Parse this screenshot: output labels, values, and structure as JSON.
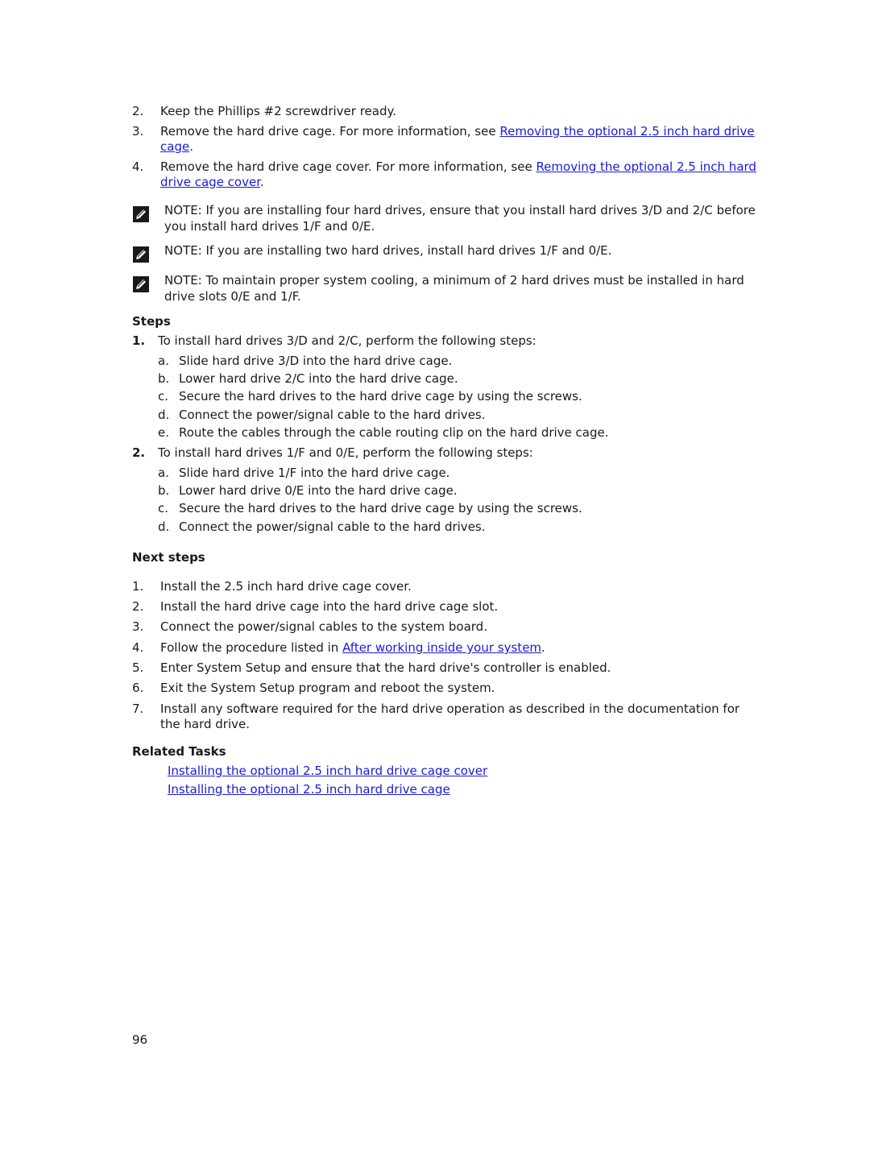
{
  "intro_steps": [
    {
      "n": "2.",
      "text": "Keep the Phillips #2 screwdriver ready.",
      "link": null,
      "after": ""
    },
    {
      "n": "3.",
      "text": "Remove the hard drive cage. For more information, see ",
      "link": "Removing the optional 2.5 inch hard drive cage",
      "after": "."
    },
    {
      "n": "4.",
      "text": "Remove the hard drive cage cover. For more information, see ",
      "link": "Removing the optional 2.5 inch hard drive cage cover",
      "after": "."
    }
  ],
  "notes": [
    {
      "label": "NOTE:",
      "text": " If you are installing four hard drives, ensure that you install hard drives 3/D and 2/C before you install hard drives 1/F and 0/E."
    },
    {
      "label": "NOTE:",
      "text": " If you are installing two hard drives, install hard drives 1/F and 0/E."
    },
    {
      "label": "NOTE:",
      "text": " To maintain proper system cooling, a minimum of 2 hard drives must be installed in hard drive slots 0/E and 1/F."
    }
  ],
  "steps_heading": "Steps",
  "steps": [
    {
      "n": "1.",
      "text": "To install hard drives 3/D and 2/C, perform the following steps:",
      "sub": [
        {
          "n": "a.",
          "text": "Slide hard drive 3/D into the hard drive cage."
        },
        {
          "n": "b.",
          "text": "Lower hard drive 2/C into the hard drive cage."
        },
        {
          "n": "c.",
          "text": "Secure the hard drives to the hard drive cage by using the screws."
        },
        {
          "n": "d.",
          "text": "Connect the power/signal cable to the hard drives."
        },
        {
          "n": "e.",
          "text": "Route the cables through the cable routing clip on the hard drive cage."
        }
      ]
    },
    {
      "n": "2.",
      "text": "To install hard drives 1/F and 0/E, perform the following steps:",
      "sub": [
        {
          "n": "a.",
          "text": "Slide hard drive 1/F into the hard drive cage."
        },
        {
          "n": "b.",
          "text": "Lower hard drive 0/E into the hard drive cage."
        },
        {
          "n": "c.",
          "text": "Secure the hard drives to the hard drive cage by using the screws."
        },
        {
          "n": "d.",
          "text": "Connect the power/signal cable to the hard drives."
        }
      ]
    }
  ],
  "next_heading": "Next steps",
  "next_steps": [
    {
      "n": "1.",
      "text": "Install the 2.5 inch hard drive cage cover.",
      "link": null,
      "after": ""
    },
    {
      "n": "2.",
      "text": "Install the hard drive cage into the hard drive cage slot.",
      "link": null,
      "after": ""
    },
    {
      "n": "3.",
      "text": "Connect the power/signal cables to the system board.",
      "link": null,
      "after": ""
    },
    {
      "n": "4.",
      "text": "Follow the procedure listed in ",
      "link": "After working inside your system",
      "after": "."
    },
    {
      "n": "5.",
      "text": "Enter System Setup and ensure that the hard drive's controller is enabled.",
      "link": null,
      "after": ""
    },
    {
      "n": "6.",
      "text": "Exit the System Setup program and reboot the system.",
      "link": null,
      "after": ""
    },
    {
      "n": "7.",
      "text": "Install any software required for the hard drive operation as described in the documentation for the hard drive.",
      "link": null,
      "after": ""
    }
  ],
  "related_heading": "Related Tasks",
  "related": [
    "Installing the optional 2.5 inch hard drive cage cover",
    "Installing the optional 2.5 inch hard drive cage"
  ],
  "page_number": "96",
  "colors": {
    "link": "#1a1adc",
    "text": "#1a1a1a"
  }
}
